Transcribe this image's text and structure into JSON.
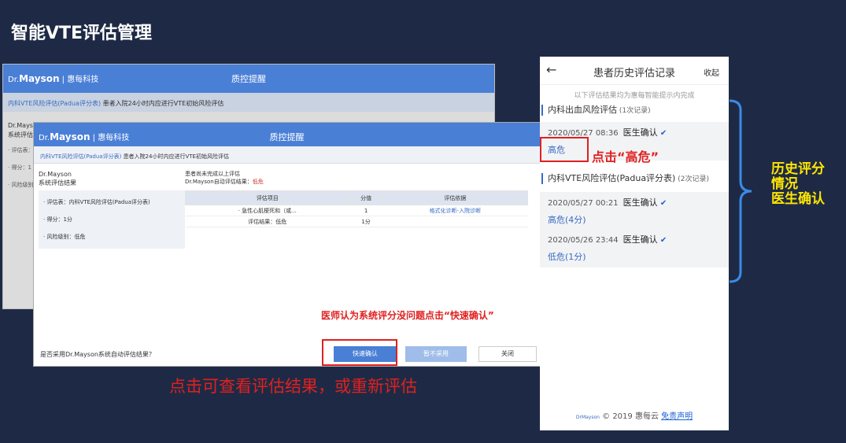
{
  "slide_title": "智能VTE评估管理",
  "desktop": {
    "logo_prefix": "Dr.",
    "logo_brand": "Mayson",
    "logo_company": " | 惠每科技",
    "header_title": "质控提醒",
    "subheader_link": "内科VTE风险评估(Padua评分表)",
    "subheader_text": "患者入院24小时内应进行VTE初始风险评估",
    "back_left_title": "Dr.Mayson",
    "back_left_sub": "系统评估结",
    "back_left_items": [
      "· 评估表：",
      "· 得分：1",
      "· 风险级别"
    ],
    "front_left_title": "Dr.Mayson",
    "front_left_sub": "系统评估结果",
    "front_left_items": [
      "· 评估表：内科VTE风险评估(Padua评分表)",
      "· 得分：1分",
      "· 风险级别：低危"
    ],
    "note_line1": "患者尚未完成以上评估",
    "note_line2_prefix": "Dr.Mayson自动评估结果：",
    "note_line2_value": "低危",
    "table": {
      "headers": [
        "评估项目",
        "分值",
        "评估依据"
      ],
      "rows": [
        [
          "· 急性心肌梗死和（或...",
          "1",
          "格式化诊断-入院诊断"
        ]
      ],
      "result_label": "评估结果：低危",
      "result_score": "1分"
    },
    "footer_question": "是否采用Dr.Mayson系统自动评估结果？",
    "buttons": {
      "quick": "快速确认",
      "skip": "暂不采用",
      "close": "关闭"
    }
  },
  "annotations": {
    "quick_confirm": "医师认为系统评分没问题点击“快速确认”",
    "caption": "点击可查看评估结果，或重新评估",
    "click_high": "点击“高危”",
    "right": [
      "历史评分",
      "情况",
      "医生确认"
    ]
  },
  "mobile": {
    "back_glyph": "←",
    "title": "患者历史评估记录",
    "collapse": "收起",
    "note": "以下评估结果均为惠每智能提示内完成",
    "sections": [
      {
        "name": "内科出血风险评估",
        "count": " (1次记录)",
        "records": [
          {
            "time": "2020/05/27 08:36",
            "doc": "医生确认",
            "level": "高危"
          }
        ]
      },
      {
        "name": "内科VTE风险评估(Padua评分表)",
        "count": " (2次记录)",
        "records": [
          {
            "time": "2020/05/27 00:21",
            "doc": "医生确认",
            "level": "高危(4分)"
          },
          {
            "time": "2020/05/26 23:44",
            "doc": "医生确认",
            "level": "低危(1分)"
          }
        ]
      }
    ],
    "check_glyph": "✔",
    "footer_brand": "DrMayson",
    "footer_text": "© 2019 惠每云",
    "footer_link": "免责声明"
  }
}
